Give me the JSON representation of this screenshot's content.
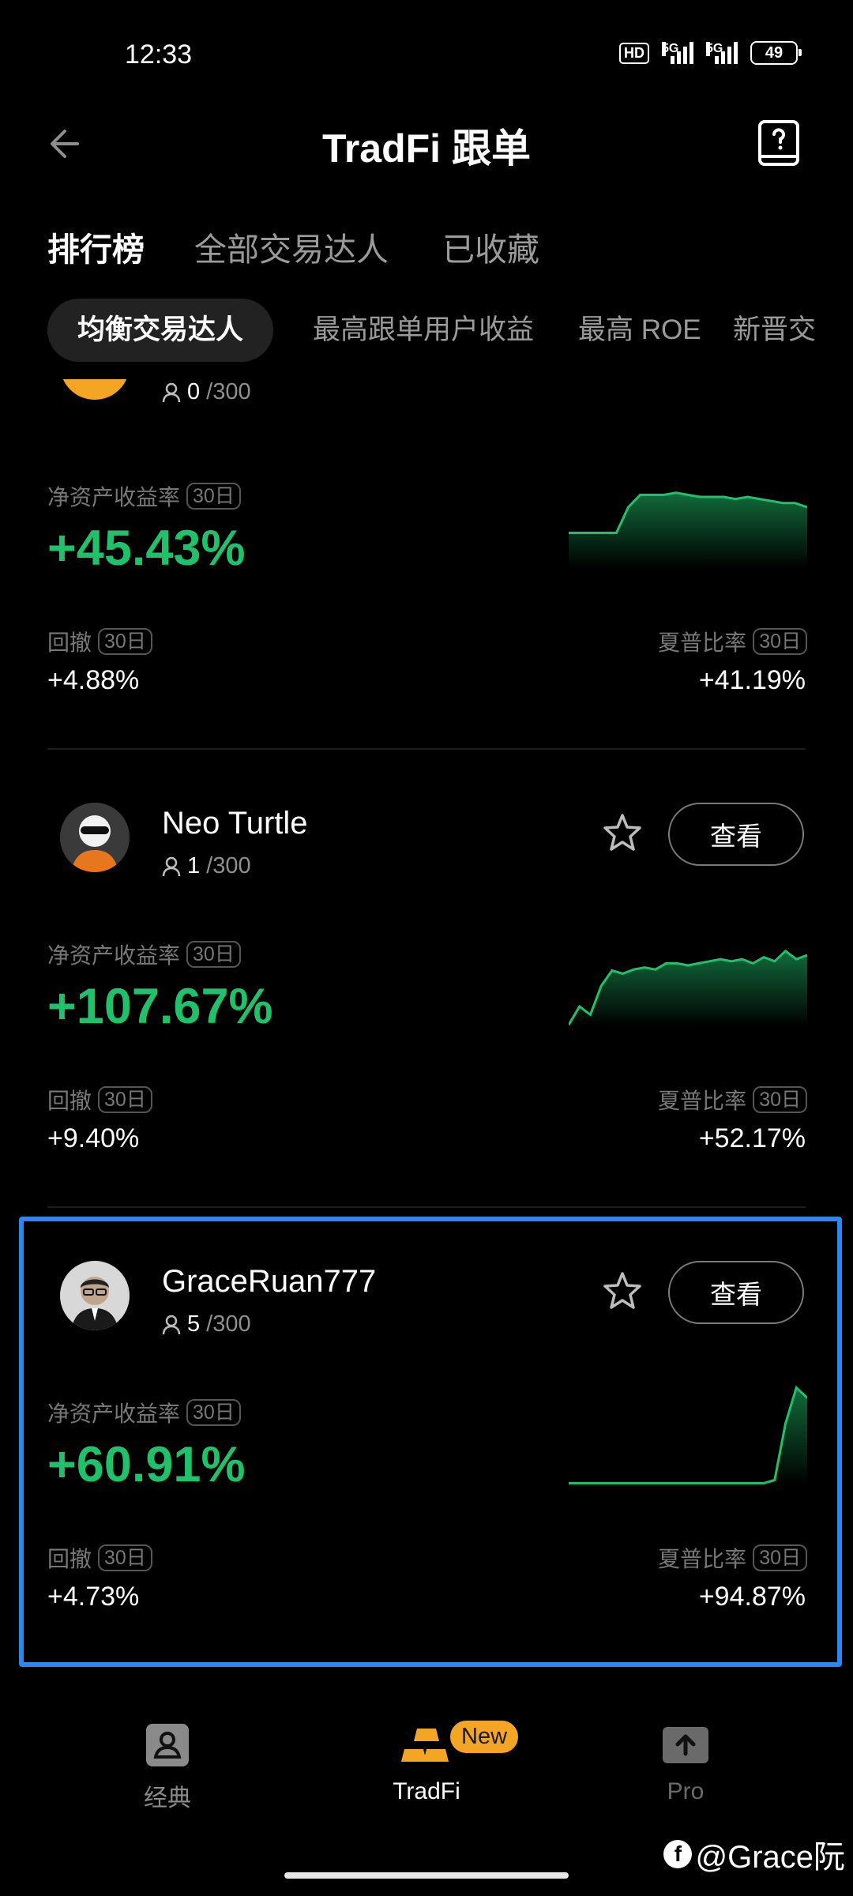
{
  "status_bar": {
    "time": "12:33",
    "hd": "HD",
    "net1": "5G",
    "net2": "5G",
    "battery": "49"
  },
  "header": {
    "title": "TradFi 跟单"
  },
  "tabs": [
    {
      "label": "排行榜"
    },
    {
      "label": "全部交易达人"
    },
    {
      "label": "已收藏"
    }
  ],
  "filters": [
    {
      "label": "均衡交易达人"
    },
    {
      "label": "最高跟单用户收益"
    },
    {
      "label": "最高 ROE"
    },
    {
      "label": "新晋交"
    }
  ],
  "labels": {
    "roe": "净资产收益率",
    "drawdown": "回撤",
    "sharpe": "夏普比率",
    "period": "30日",
    "view": "查看"
  },
  "traders": [
    {
      "name": "",
      "followers": "0",
      "capacity": "/300",
      "roe": "+45.43%",
      "drawdown": "+4.88%",
      "sharpe": "+41.19%",
      "spark": [
        0.35,
        0.35,
        0.35,
        0.35,
        0.35,
        0.6,
        0.72,
        0.72,
        0.72,
        0.74,
        0.72,
        0.7,
        0.7,
        0.7,
        0.68,
        0.7,
        0.68,
        0.66,
        0.64,
        0.64,
        0.6
      ]
    },
    {
      "name": "Neo Turtle",
      "followers": "1",
      "capacity": "/300",
      "roe": "+107.67%",
      "drawdown": "+9.40%",
      "sharpe": "+52.17%",
      "spark": [
        0.02,
        0.2,
        0.12,
        0.4,
        0.55,
        0.52,
        0.56,
        0.58,
        0.56,
        0.62,
        0.62,
        0.6,
        0.62,
        0.64,
        0.66,
        0.64,
        0.66,
        0.62,
        0.68,
        0.64,
        0.74,
        0.66,
        0.7
      ]
    },
    {
      "name": "GraceRuan777",
      "followers": "5",
      "capacity": "/300",
      "roe": "+60.91%",
      "drawdown": "+4.73%",
      "sharpe": "+94.87%",
      "spark": [
        0.02,
        0.02,
        0.02,
        0.02,
        0.02,
        0.02,
        0.02,
        0.02,
        0.02,
        0.02,
        0.02,
        0.02,
        0.02,
        0.02,
        0.02,
        0.02,
        0.02,
        0.02,
        0.02,
        0.05,
        0.6,
        0.95,
        0.85
      ]
    }
  ],
  "bottom_nav": [
    {
      "label": "经典"
    },
    {
      "label": "TradFi",
      "badge": "New"
    },
    {
      "label": "Pro"
    }
  ],
  "watermark": "@Grace阮",
  "colors": {
    "accent_green": "#1fc26b",
    "highlight_blue": "#2e86f0",
    "badge_orange": "#f5a524"
  }
}
